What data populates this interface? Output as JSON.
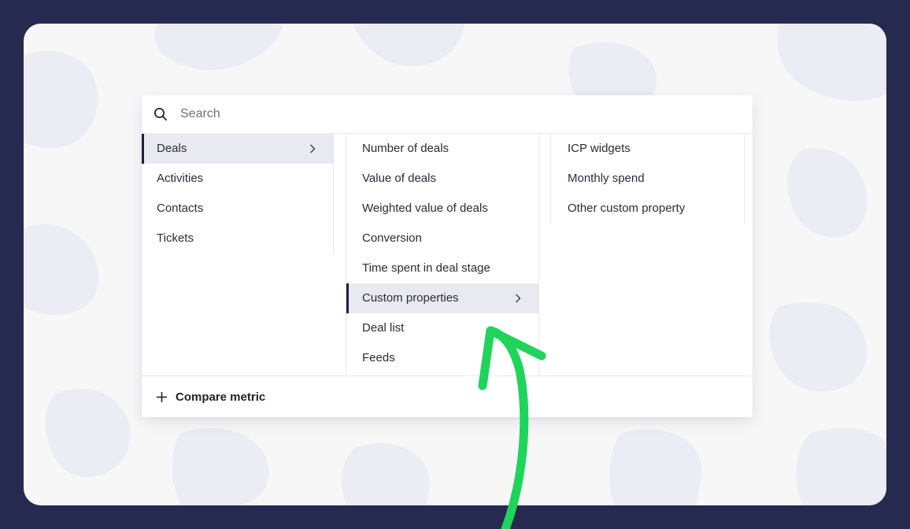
{
  "search": {
    "placeholder": "Search",
    "icon": "search-icon"
  },
  "categories": [
    {
      "label": "Deals",
      "selected": true
    },
    {
      "label": "Activities"
    },
    {
      "label": "Contacts"
    },
    {
      "label": "Tickets"
    }
  ],
  "metrics": [
    {
      "label": "Number of deals"
    },
    {
      "label": "Value of deals"
    },
    {
      "label": "Weighted value of deals"
    },
    {
      "label": "Conversion"
    },
    {
      "label": "Time spent in deal stage"
    },
    {
      "label": "Custom properties",
      "selected": true
    },
    {
      "label": "Deal list"
    },
    {
      "label": "Feeds"
    }
  ],
  "custom_properties": [
    {
      "label": "ICP widgets"
    },
    {
      "label": "Monthly spend"
    },
    {
      "label": "Other custom property"
    }
  ],
  "footer": {
    "compare_label": "Compare metric",
    "icon": "plus-icon"
  },
  "colors": {
    "page_background": "#262950",
    "card_background": "#f7f7f8",
    "selected_row": "#e9e9f2",
    "selection_bar": "#1d1f3f",
    "annotation_arrow": "#1ed45a"
  }
}
